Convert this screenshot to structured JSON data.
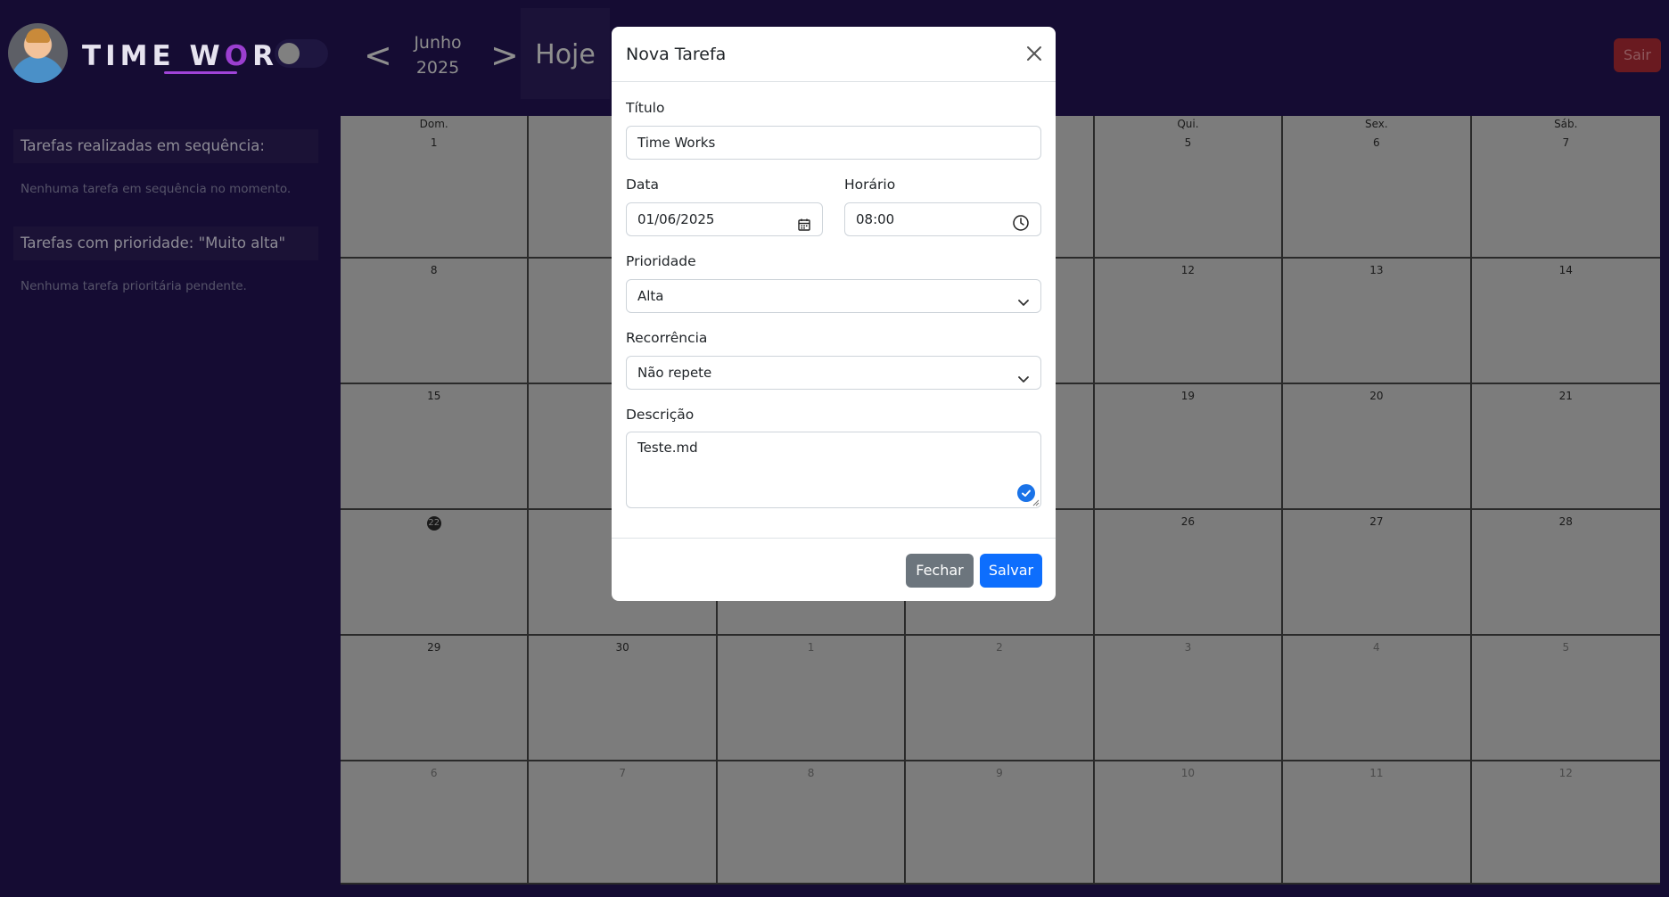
{
  "header": {
    "logo_text_left": "TIME W",
    "logo_text_o": "O",
    "logo_text_right": "RKS",
    "prev_arrow": "<",
    "next_arrow": ">",
    "month": "Junho",
    "year": "2025",
    "today_label": "Hoje",
    "logout_label": "Sair"
  },
  "sidebar": {
    "streak_title": "Tarefas realizadas em sequência:",
    "streak_empty": "Nenhuma tarefa em sequência no momento.",
    "priority_title": "Tarefas com prioridade: \"Muito alta\"",
    "priority_empty": "Nenhuma tarefa prioritária pendente."
  },
  "calendar": {
    "weekdays": [
      "Dom.",
      "",
      "",
      "",
      "Qui.",
      "Sex.",
      "Sáb."
    ],
    "weeks": [
      [
        "1",
        "",
        "",
        "",
        "5",
        "6",
        "7"
      ],
      [
        "8",
        "",
        "",
        "",
        "12",
        "13",
        "14"
      ],
      [
        "15",
        "",
        "",
        "",
        "19",
        "20",
        "21"
      ],
      [
        "22",
        "",
        "",
        "",
        "26",
        "27",
        "28"
      ],
      [
        "29",
        "30",
        "1",
        "2",
        "3",
        "4",
        "5"
      ],
      [
        "6",
        "7",
        "8",
        "9",
        "10",
        "11",
        "12"
      ]
    ],
    "today": "22"
  },
  "modal": {
    "title": "Nova Tarefa",
    "title_label": "Título",
    "title_value": "Time Works",
    "date_label": "Data",
    "date_value": "01/06/2025",
    "time_label": "Horário",
    "time_value": "08:00",
    "priority_label": "Prioridade",
    "priority_value": "Alta",
    "recurrence_label": "Recorrência",
    "recurrence_value": "Não repete",
    "description_label": "Descrição",
    "description_value": "Teste.md",
    "close_button": "Fechar",
    "save_button": "Salvar"
  },
  "colors": {
    "background": "#150c33",
    "calendar": "#7c7c7c",
    "primary": "#0d6efd",
    "secondary": "#6c757d",
    "logout": "#6a1a20",
    "accent": "#a044d9"
  }
}
